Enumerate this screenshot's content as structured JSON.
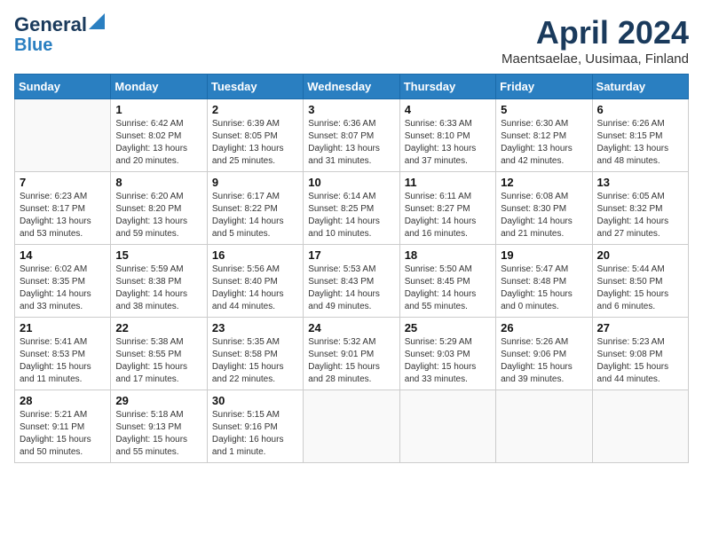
{
  "logo": {
    "line1": "General",
    "line2": "Blue"
  },
  "title": "April 2024",
  "location": "Maentsaelae, Uusimaa, Finland",
  "days_of_week": [
    "Sunday",
    "Monday",
    "Tuesday",
    "Wednesday",
    "Thursday",
    "Friday",
    "Saturday"
  ],
  "weeks": [
    [
      {
        "num": "",
        "info": ""
      },
      {
        "num": "1",
        "info": "Sunrise: 6:42 AM\nSunset: 8:02 PM\nDaylight: 13 hours\nand 20 minutes."
      },
      {
        "num": "2",
        "info": "Sunrise: 6:39 AM\nSunset: 8:05 PM\nDaylight: 13 hours\nand 25 minutes."
      },
      {
        "num": "3",
        "info": "Sunrise: 6:36 AM\nSunset: 8:07 PM\nDaylight: 13 hours\nand 31 minutes."
      },
      {
        "num": "4",
        "info": "Sunrise: 6:33 AM\nSunset: 8:10 PM\nDaylight: 13 hours\nand 37 minutes."
      },
      {
        "num": "5",
        "info": "Sunrise: 6:30 AM\nSunset: 8:12 PM\nDaylight: 13 hours\nand 42 minutes."
      },
      {
        "num": "6",
        "info": "Sunrise: 6:26 AM\nSunset: 8:15 PM\nDaylight: 13 hours\nand 48 minutes."
      }
    ],
    [
      {
        "num": "7",
        "info": "Sunrise: 6:23 AM\nSunset: 8:17 PM\nDaylight: 13 hours\nand 53 minutes."
      },
      {
        "num": "8",
        "info": "Sunrise: 6:20 AM\nSunset: 8:20 PM\nDaylight: 13 hours\nand 59 minutes."
      },
      {
        "num": "9",
        "info": "Sunrise: 6:17 AM\nSunset: 8:22 PM\nDaylight: 14 hours\nand 5 minutes."
      },
      {
        "num": "10",
        "info": "Sunrise: 6:14 AM\nSunset: 8:25 PM\nDaylight: 14 hours\nand 10 minutes."
      },
      {
        "num": "11",
        "info": "Sunrise: 6:11 AM\nSunset: 8:27 PM\nDaylight: 14 hours\nand 16 minutes."
      },
      {
        "num": "12",
        "info": "Sunrise: 6:08 AM\nSunset: 8:30 PM\nDaylight: 14 hours\nand 21 minutes."
      },
      {
        "num": "13",
        "info": "Sunrise: 6:05 AM\nSunset: 8:32 PM\nDaylight: 14 hours\nand 27 minutes."
      }
    ],
    [
      {
        "num": "14",
        "info": "Sunrise: 6:02 AM\nSunset: 8:35 PM\nDaylight: 14 hours\nand 33 minutes."
      },
      {
        "num": "15",
        "info": "Sunrise: 5:59 AM\nSunset: 8:38 PM\nDaylight: 14 hours\nand 38 minutes."
      },
      {
        "num": "16",
        "info": "Sunrise: 5:56 AM\nSunset: 8:40 PM\nDaylight: 14 hours\nand 44 minutes."
      },
      {
        "num": "17",
        "info": "Sunrise: 5:53 AM\nSunset: 8:43 PM\nDaylight: 14 hours\nand 49 minutes."
      },
      {
        "num": "18",
        "info": "Sunrise: 5:50 AM\nSunset: 8:45 PM\nDaylight: 14 hours\nand 55 minutes."
      },
      {
        "num": "19",
        "info": "Sunrise: 5:47 AM\nSunset: 8:48 PM\nDaylight: 15 hours\nand 0 minutes."
      },
      {
        "num": "20",
        "info": "Sunrise: 5:44 AM\nSunset: 8:50 PM\nDaylight: 15 hours\nand 6 minutes."
      }
    ],
    [
      {
        "num": "21",
        "info": "Sunrise: 5:41 AM\nSunset: 8:53 PM\nDaylight: 15 hours\nand 11 minutes."
      },
      {
        "num": "22",
        "info": "Sunrise: 5:38 AM\nSunset: 8:55 PM\nDaylight: 15 hours\nand 17 minutes."
      },
      {
        "num": "23",
        "info": "Sunrise: 5:35 AM\nSunset: 8:58 PM\nDaylight: 15 hours\nand 22 minutes."
      },
      {
        "num": "24",
        "info": "Sunrise: 5:32 AM\nSunset: 9:01 PM\nDaylight: 15 hours\nand 28 minutes."
      },
      {
        "num": "25",
        "info": "Sunrise: 5:29 AM\nSunset: 9:03 PM\nDaylight: 15 hours\nand 33 minutes."
      },
      {
        "num": "26",
        "info": "Sunrise: 5:26 AM\nSunset: 9:06 PM\nDaylight: 15 hours\nand 39 minutes."
      },
      {
        "num": "27",
        "info": "Sunrise: 5:23 AM\nSunset: 9:08 PM\nDaylight: 15 hours\nand 44 minutes."
      }
    ],
    [
      {
        "num": "28",
        "info": "Sunrise: 5:21 AM\nSunset: 9:11 PM\nDaylight: 15 hours\nand 50 minutes."
      },
      {
        "num": "29",
        "info": "Sunrise: 5:18 AM\nSunset: 9:13 PM\nDaylight: 15 hours\nand 55 minutes."
      },
      {
        "num": "30",
        "info": "Sunrise: 5:15 AM\nSunset: 9:16 PM\nDaylight: 16 hours\nand 1 minute."
      },
      {
        "num": "",
        "info": ""
      },
      {
        "num": "",
        "info": ""
      },
      {
        "num": "",
        "info": ""
      },
      {
        "num": "",
        "info": ""
      }
    ]
  ]
}
